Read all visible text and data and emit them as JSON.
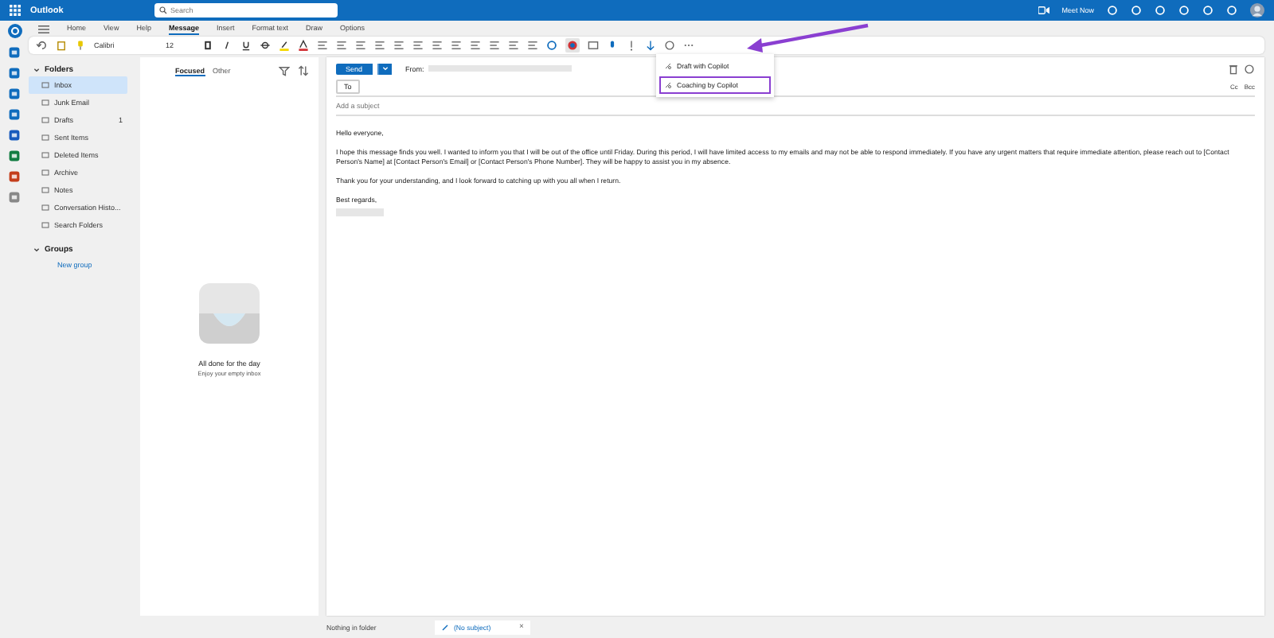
{
  "app": {
    "title": "Outlook",
    "search": {
      "placeholder": "Search"
    },
    "meet_now": "Meet Now"
  },
  "ribbon": {
    "tabs": [
      {
        "label": "Home",
        "selected": false
      },
      {
        "label": "View",
        "selected": false
      },
      {
        "label": "Help",
        "selected": false
      },
      {
        "label": "Message",
        "selected": true
      },
      {
        "label": "Insert",
        "selected": false
      },
      {
        "label": "Format text",
        "selected": false
      },
      {
        "label": "Draw",
        "selected": false
      },
      {
        "label": "Options",
        "selected": false
      }
    ],
    "font": "Calibri",
    "size": "12"
  },
  "copilot_menu": {
    "items": [
      {
        "label": "Draft with Copilot",
        "highlighted": false
      },
      {
        "label": "Coaching by Copilot",
        "highlighted": true
      }
    ]
  },
  "folders": {
    "title": "Folders",
    "expanded": true,
    "items": [
      {
        "label": "Inbox",
        "selected": true
      },
      {
        "label": "Junk Email",
        "selected": false
      },
      {
        "label": "Drafts",
        "selected": false,
        "count": "1"
      },
      {
        "label": "Sent Items",
        "selected": false
      },
      {
        "label": "Deleted Items",
        "selected": false
      },
      {
        "label": "Archive",
        "selected": false
      },
      {
        "label": "Notes",
        "selected": false
      },
      {
        "label": "Conversation Histo...",
        "selected": false
      },
      {
        "label": "Search Folders",
        "selected": false
      }
    ],
    "groups_title": "Groups",
    "new_group": "New group"
  },
  "list": {
    "tabs": [
      {
        "label": "Focused",
        "selected": true
      },
      {
        "label": "Other",
        "selected": false
      }
    ],
    "empty_title": "All done for the day",
    "empty_subtitle": "Enjoy your empty inbox"
  },
  "compose": {
    "send": "Send",
    "from_label": "From:",
    "to_label": "To",
    "cc": "Cc",
    "bcc": "Bcc",
    "subject_placeholder": "Add a subject",
    "body": [
      "Hello everyone,",
      "I hope this message finds you well. I wanted to inform you that I will be out of the office until Friday. During this period, I will have limited access to my emails and may not be able to respond immediately. If you have any urgent matters that require immediate attention, please reach out to [Contact Person's Name] at [Contact Person's Email] or [Contact Person's Phone Number]. They will be happy to assist you in my absence.",
      "Thank you for your understanding, and I look forward to catching up with you all when I return.",
      "Best regards,"
    ]
  },
  "status_bar": {
    "folder_note": "Nothing in folder",
    "draft_tab": "(No subject)",
    "close": "×"
  }
}
